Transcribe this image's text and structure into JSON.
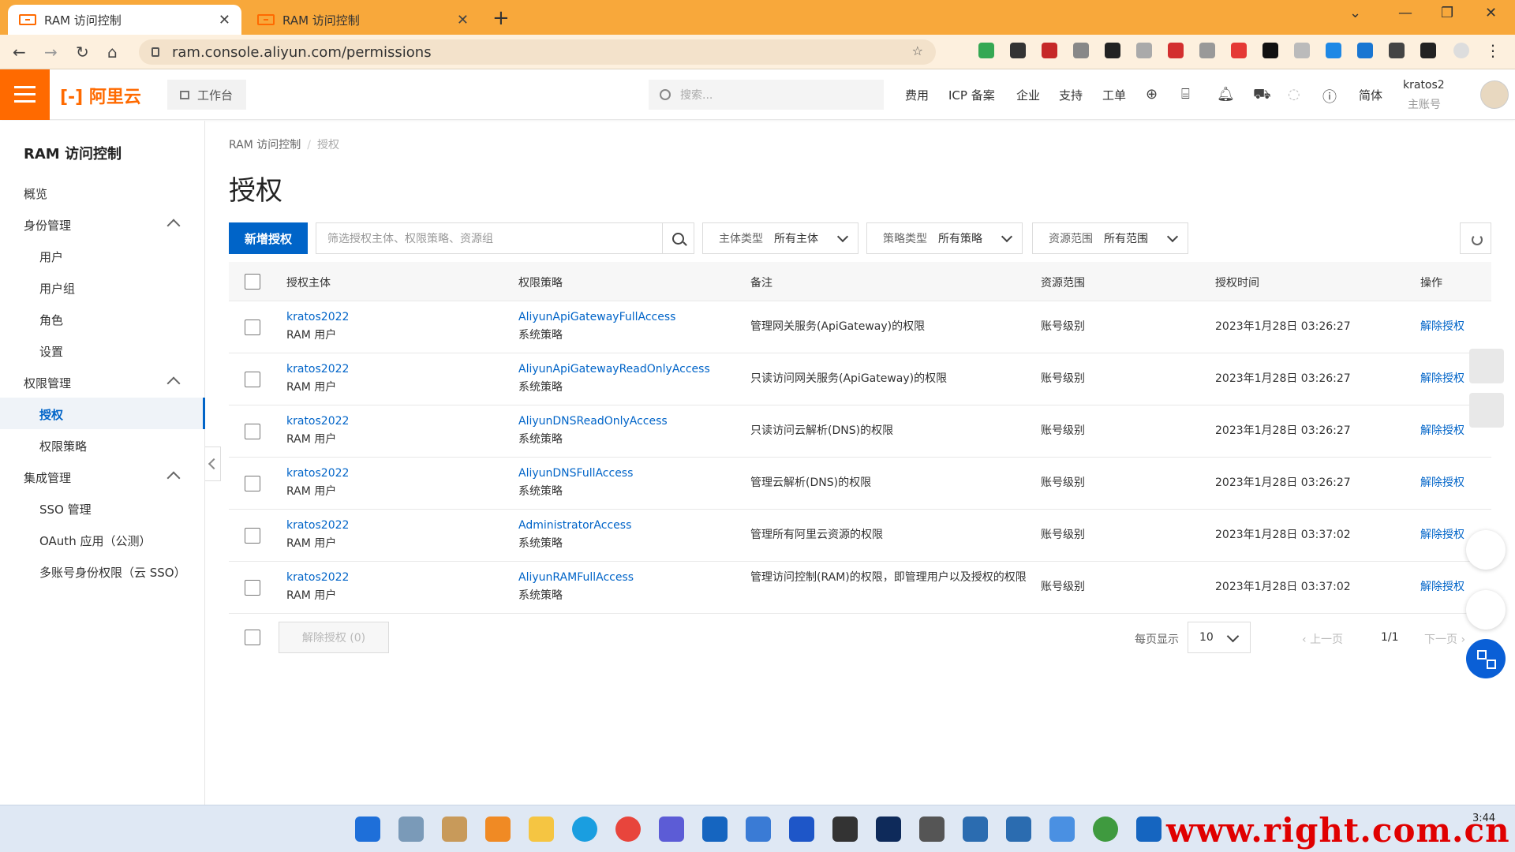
{
  "browser": {
    "tabs": [
      {
        "title": "RAM 访问控制",
        "active": true
      },
      {
        "title": "RAM 访问控制",
        "active": false
      }
    ],
    "url": "ram.console.aliyun.com/permissions"
  },
  "topbar": {
    "logo": "阿里云",
    "workbench": "工作台",
    "search_placeholder": "搜索...",
    "links": [
      "费用",
      "ICP 备案",
      "企业",
      "支持",
      "工单"
    ],
    "lang": "简体",
    "user_name": "kratos2",
    "user_type": "主账号"
  },
  "sidebar": {
    "title": "RAM 访问控制",
    "overview": "概览",
    "identity": "身份管理",
    "identity_items": [
      "用户",
      "用户组",
      "角色",
      "设置"
    ],
    "permission": "权限管理",
    "permission_items": [
      "授权",
      "权限策略"
    ],
    "integration": "集成管理",
    "integration_items": [
      "SSO 管理",
      "OAuth 应用（公测）",
      "多账号身份权限（云 SSO）"
    ]
  },
  "breadcrumb": {
    "root": "RAM 访问控制",
    "current": "授权"
  },
  "page_title": "授权",
  "toolbar": {
    "add_button": "新增授权",
    "filter_placeholder": "筛选授权主体、权限策略、资源组",
    "principal_type_label": "主体类型",
    "principal_type_value": "所有主体",
    "policy_type_label": "策略类型",
    "policy_type_value": "所有策略",
    "scope_label": "资源范围",
    "scope_value": "所有范围"
  },
  "table": {
    "headers": [
      "授权主体",
      "权限策略",
      "备注",
      "资源范围",
      "授权时间",
      "操作"
    ],
    "rows": [
      {
        "principal": "kratos2022",
        "principal_type": "RAM 用户",
        "policy": "AliyunApiGatewayFullAccess",
        "policy_type": "系统策略",
        "note": "管理网关服务(ApiGateway)的权限",
        "scope": "账号级别",
        "time": "2023年1月28日 03:26:27",
        "action": "解除授权"
      },
      {
        "principal": "kratos2022",
        "principal_type": "RAM 用户",
        "policy": "AliyunApiGatewayReadOnlyAccess",
        "policy_type": "系统策略",
        "note": "只读访问网关服务(ApiGateway)的权限",
        "scope": "账号级别",
        "time": "2023年1月28日 03:26:27",
        "action": "解除授权"
      },
      {
        "principal": "kratos2022",
        "principal_type": "RAM 用户",
        "policy": "AliyunDNSReadOnlyAccess",
        "policy_type": "系统策略",
        "note": "只读访问云解析(DNS)的权限",
        "scope": "账号级别",
        "time": "2023年1月28日 03:26:27",
        "action": "解除授权"
      },
      {
        "principal": "kratos2022",
        "principal_type": "RAM 用户",
        "policy": "AliyunDNSFullAccess",
        "policy_type": "系统策略",
        "note": "管理云解析(DNS)的权限",
        "scope": "账号级别",
        "time": "2023年1月28日 03:26:27",
        "action": "解除授权"
      },
      {
        "principal": "kratos2022",
        "principal_type": "RAM 用户",
        "policy": "AdministratorAccess",
        "policy_type": "系统策略",
        "note": "管理所有阿里云资源的权限",
        "scope": "账号级别",
        "time": "2023年1月28日 03:37:02",
        "action": "解除授权"
      },
      {
        "principal": "kratos2022",
        "principal_type": "RAM 用户",
        "policy": "AliyunRAMFullAccess",
        "policy_type": "系统策略",
        "note": "管理访问控制(RAM)的权限，即管理用户以及授权的权限",
        "scope": "账号级别",
        "time": "2023年1月28日 03:37:02",
        "action": "解除授权"
      }
    ]
  },
  "footer": {
    "bulk_revoke": "解除授权 (0)",
    "page_size_label": "每页显示",
    "page_size": "10",
    "prev": "上一页",
    "page": "1/1",
    "next": "下一页"
  },
  "taskbar": {
    "watermark": "www.right.com.cn",
    "time": "3:44"
  },
  "colors": {
    "accent": "#0064c8",
    "brand": "#ff6a00",
    "tabbar": "#f8a83b"
  }
}
